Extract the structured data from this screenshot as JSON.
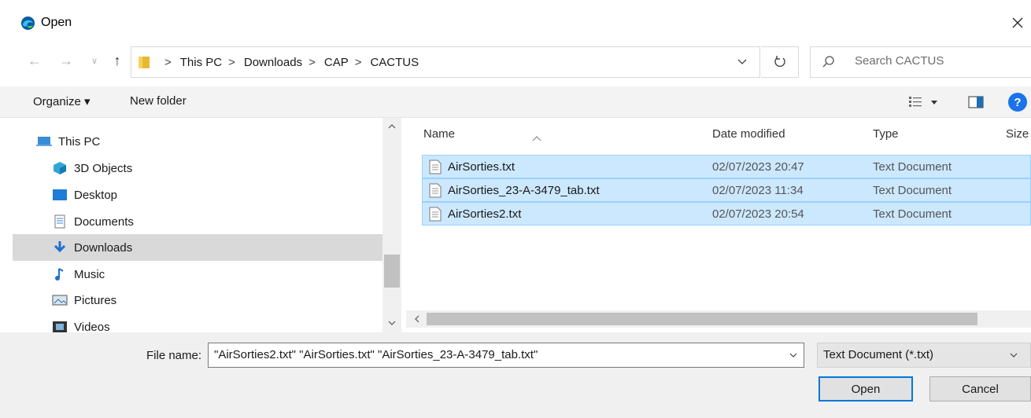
{
  "window": {
    "title": "Open",
    "close_glyph": "✕"
  },
  "nav": {
    "back": "←",
    "forward": "→",
    "recent": "∨",
    "up": "↑"
  },
  "address": {
    "crumbs": [
      "This PC",
      "Downloads",
      "CAP",
      "CACTUS"
    ],
    "separator": ">"
  },
  "search": {
    "placeholder": "Search CACTUS"
  },
  "toolbar": {
    "organize_label": "Organize ▾",
    "new_folder_label": "New folder",
    "help_label": "?"
  },
  "sidebar": {
    "items": [
      {
        "label": "This PC",
        "icon": "computer-icon"
      },
      {
        "label": "3D Objects",
        "icon": "cube-icon"
      },
      {
        "label": "Desktop",
        "icon": "desktop-icon"
      },
      {
        "label": "Documents",
        "icon": "document-icon"
      },
      {
        "label": "Downloads",
        "icon": "download-icon",
        "selected": true
      },
      {
        "label": "Music",
        "icon": "music-icon"
      },
      {
        "label": "Pictures",
        "icon": "pictures-icon"
      },
      {
        "label": "Videos",
        "icon": "film-icon"
      }
    ]
  },
  "file_list": {
    "columns": [
      "Name",
      "Date modified",
      "Type",
      "Size"
    ],
    "rows": [
      {
        "name": "AirSorties.txt",
        "date": "02/07/2023 20:47",
        "type": "Text Document"
      },
      {
        "name": "AirSorties_23-A-3479_tab.txt",
        "date": "02/07/2023 11:34",
        "type": "Text Document"
      },
      {
        "name": "AirSorties2.txt",
        "date": "02/07/2023 20:54",
        "type": "Text Document"
      }
    ]
  },
  "footer": {
    "file_name_label": "File name:",
    "file_name_value": "\"AirSorties2.txt\" \"AirSorties.txt\" \"AirSorties_23-A-3479_tab.txt\"",
    "file_type_value": "Text Document (*.txt)",
    "open_label": "Open",
    "cancel_label": "Cancel"
  },
  "colors": {
    "selection_bg": "#cce8ff",
    "selection_border": "#99d1ff",
    "accent": "#0078d7"
  }
}
